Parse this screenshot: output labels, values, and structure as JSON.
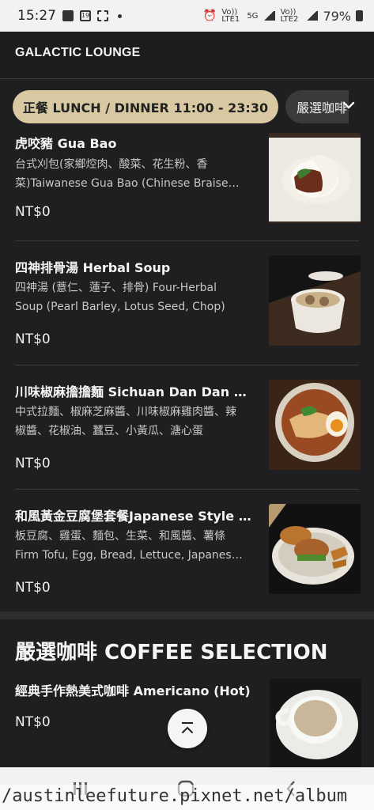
{
  "status_bar": {
    "time": "15:27",
    "notif_icons": [
      "image-icon",
      "calendar-19-icon",
      "hash-icon",
      "dot-icon"
    ],
    "calendar_day": "19",
    "net1": "Vo)) LTE1",
    "net2": "5G",
    "net3": "Vo)) LTE2",
    "battery": "79%"
  },
  "header": {
    "title": "GALACTIC LOUNGE"
  },
  "categories": {
    "active": "正餐 LUNCH / DINNER 11:00 - 23:30",
    "next": "嚴選咖啡"
  },
  "menu_items": [
    {
      "name": "虎咬豬 Gua Bao",
      "desc": "台式刈包(家鄉焢肉、酸菜、花生粉、香菜)Taiwanese Gua Bao (Chinese Braised Pork, Pickled Mustard, Peanut Powder, Cilantro)",
      "price": "NT$0",
      "image": "gua-bao-photo"
    },
    {
      "name": "四神排骨湯 Herbal Soup",
      "desc": "四神湯 (薏仁、蓮子、排骨) Four-Herbal Soup (Pearl Barley, Lotus Seed, Chop)",
      "price": "NT$0",
      "image": "herbal-soup-photo"
    },
    {
      "name": "川味椒麻擔擔麵 Sichuan Dan Dan Noodles",
      "desc": "中式拉麵、椒麻芝麻醬、川味椒麻雞肉醬、辣椒醬、花椒油、蠶豆、小黃瓜、溏心蛋",
      "price": "NT$0",
      "image": "dan-dan-noodles-photo"
    },
    {
      "name": "和風黃金豆腐堡套餐Japanese Style Tofu Burger",
      "desc": "板豆腐、雞蛋、麵包、生菜、和風醬、薯條 Firm Tofu, Egg, Bread, Lettuce, Japanese Sauce, Fries",
      "price": "NT$0",
      "image": "tofu-burger-photo"
    }
  ],
  "coffee_section": {
    "title": "嚴選咖啡 COFFEE SELECTION",
    "item": {
      "name": "經典手作熱美式咖啡 Americano (Hot)",
      "price": "NT$0",
      "image": "americano-photo"
    }
  },
  "watermark": "/austinleefuture.pixnet.net/album",
  "colors": {
    "accent": "#d9c9a3",
    "background": "#1f1f21",
    "divider": "#3a3a3c"
  }
}
